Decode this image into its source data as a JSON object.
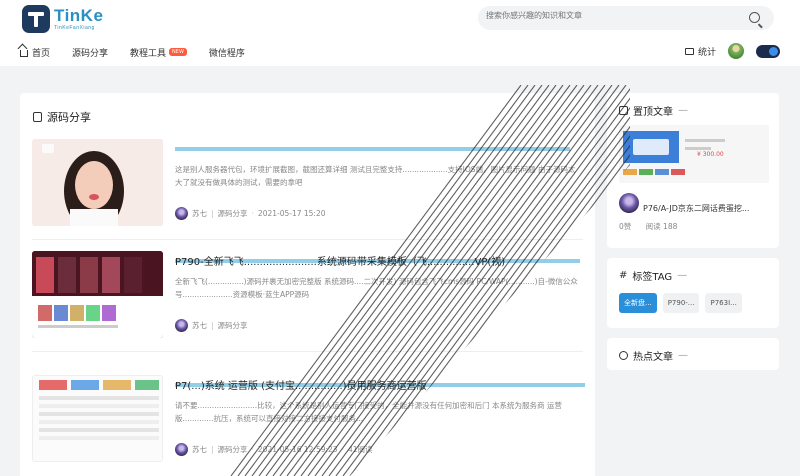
{
  "header": {
    "logo_main": "TinKe",
    "logo_sub": "TinKeFanXiang",
    "search_placeholder": "搜索你感兴趣的知识和文章",
    "nav": [
      {
        "label": "首页"
      },
      {
        "label": "源码分享"
      },
      {
        "label": "教程工具",
        "badge": "NEW"
      },
      {
        "label": "微信程序"
      }
    ],
    "stats_label": "统计"
  },
  "main": {
    "section_title": "源码分享",
    "posts": [
      {
        "title": "",
        "excerpt": "这是别人服务器代包，环境扩展截图，截图还算详细 测试且完整支持...................支持IOS端，图片显示问题 由于源码太大了就没有做具体的测试，需要的拿吧",
        "author": "苏七",
        "category": "源码分享",
        "date": "2021-05-17 15:20",
        "views": ""
      },
      {
        "title": "P790-全新飞飞.......................系统源码带采集模板（飞...............VP(视)",
        "excerpt": "全新飞飞(...............)源码并裹无加密完整版 系统源码....二次开发) 源码包含飞飞cms源码 PC/WAP(...........)自-微信公众号.....................资源模板·蓝生APP源码",
        "author": "苏七",
        "category": "源码分享",
        "date": "",
        "views": ""
      },
      {
        "title": "P7(...)系统 运营版 (支付宝...............)员用服务商运营版",
        "excerpt": "请不要.........................比较，这个系统是别人运营专门接受的，全能并源没有任何加密和后门 本系统为服务商 运营版.............抗压，系统可以直接对接二方接接支付服务...",
        "author": "苏七",
        "category": "源码分享",
        "date": "2021-05-16 12:59:23",
        "views": "41阅读"
      }
    ]
  },
  "sidebar": {
    "pinned_title": "置顶文章",
    "pinned_post_title": "P76/A-JD京东二网话费蛋挖...",
    "pinned_likes": "0赞",
    "pinned_views": "阅读 188",
    "pinned_thumb_price": "¥ 300.00",
    "tags_title": "标签TAG",
    "tags": [
      "全新盘...",
      "P790-...",
      "P763I..."
    ],
    "hot_title": "热点文章"
  },
  "colors": {
    "brand": "#2a8fc1",
    "accent": "#2a8fd8",
    "badge_new": "#ff5a3c",
    "toggle_bg": "#1a2b4c"
  }
}
